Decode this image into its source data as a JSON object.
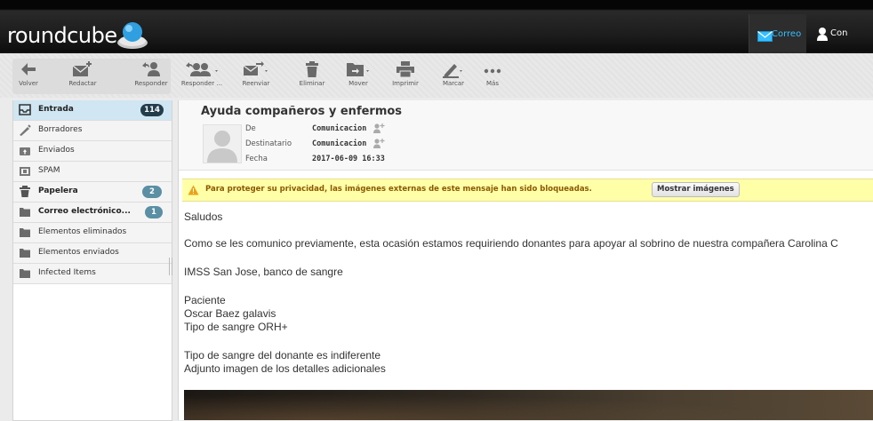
{
  "app": {
    "logo_text": "roundcube",
    "nav": {
      "mail": "Correo",
      "contacts": "Con"
    }
  },
  "toolbar": {
    "back": "Volver",
    "compose": "Redactar",
    "reply": "Responder",
    "reply_all": "Responder ...",
    "forward": "Reenviar",
    "delete": "Eliminar",
    "move": "Mover",
    "print": "Imprimir",
    "mark": "Marcar",
    "more": "Más"
  },
  "folders": [
    {
      "name": "Entrada",
      "badge": "114",
      "icon": "inbox-icon",
      "selected": true,
      "bold": true
    },
    {
      "name": "Borradores",
      "badge": "",
      "icon": "drafts-pencil-icon"
    },
    {
      "name": "Enviados",
      "badge": "",
      "icon": "sent-icon"
    },
    {
      "name": "SPAM",
      "badge": "",
      "icon": "spam-icon"
    },
    {
      "name": "Papelera",
      "badge": "2",
      "icon": "trash-icon",
      "bold": true
    },
    {
      "name": "Correo electrónico...",
      "badge": "1",
      "icon": "folder-icon",
      "bold": true
    },
    {
      "name": "Elementos eliminados",
      "badge": "",
      "icon": "folder-icon"
    },
    {
      "name": "Elementos enviados",
      "badge": "",
      "icon": "folder-icon"
    },
    {
      "name": "Infected Items",
      "badge": "",
      "icon": "folder-icon"
    }
  ],
  "message": {
    "subject": "Ayuda compañeros y enfermos",
    "from_label": "De",
    "from_value": "Comunicacion",
    "to_label": "Destinatario",
    "to_value": "Comunicacion",
    "date_label": "Fecha",
    "date_value": "2017-06-09 16:33",
    "warning_text": "Para proteger su privacidad, las imágenes externas de este mensaje han sido bloqueadas.",
    "show_images": "Mostrar imágenes",
    "body": {
      "greeting": "Saludos",
      "p1": "Como se les comunico previamente, esta ocasión estamos requiriendo donantes para apoyar al sobrino de nuestra compañera Carolina C",
      "p2": "IMSS San Jose, banco de sangre",
      "p3a": "Paciente",
      "p3b": "Oscar Baez galavis",
      "p3c": "Tipo de sangre ORH+",
      "p4a": "Tipo de sangre del donante es indiferente",
      "p4b": "Adjunto imagen de los detalles adicionales"
    }
  },
  "colors": {
    "accent": "#37beff",
    "selected_folder": "#d0e6f2",
    "badge": "#5b8fa3",
    "warning_bg": "#ffffa8"
  }
}
